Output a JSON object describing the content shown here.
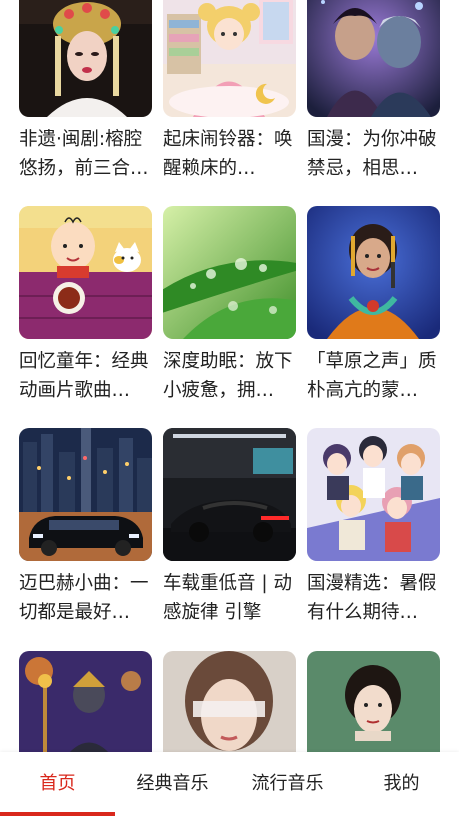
{
  "cards": [
    {
      "title": "非遗·闽剧:榕腔悠扬，前三合…",
      "image": "opera-performer-image"
    },
    {
      "title": "起床闹铃器：唤醒赖床的…",
      "image": "sailor-moon-bedroom-image"
    },
    {
      "title": "国漫：为你冲破禁忌，相思…",
      "image": "anime-couple-image"
    },
    {
      "title": "回忆童年：经典动画片歌曲…",
      "image": "cartoon-boy-cat-image"
    },
    {
      "title": "深度助眠：放下小疲惫，拥…",
      "image": "raindrops-leaf-image"
    },
    {
      "title": "「草原之声」质朴高亢的蒙…",
      "image": "ethnic-singer-image"
    },
    {
      "title": "迈巴赫小曲：一切都是最好…",
      "image": "car-city-night-image"
    },
    {
      "title": "车载重低音 | 动感旋律 引擎轰…",
      "image": "sports-car-garage-image"
    },
    {
      "title": "国漫精选：暑假有什么期待…",
      "image": "anime-group-image"
    },
    {
      "title": "",
      "image": "armored-warrior-image"
    },
    {
      "title": "",
      "image": "blindfold-woman-image"
    },
    {
      "title": "",
      "image": "vintage-actress-image"
    }
  ],
  "tabs": [
    {
      "label": "首页",
      "active": true
    },
    {
      "label": "经典音乐",
      "active": false
    },
    {
      "label": "流行音乐",
      "active": false
    },
    {
      "label": "我的",
      "active": false
    }
  ],
  "colors": {
    "accent": "#d9281c",
    "text": "#222222",
    "background": "#ffffff"
  }
}
